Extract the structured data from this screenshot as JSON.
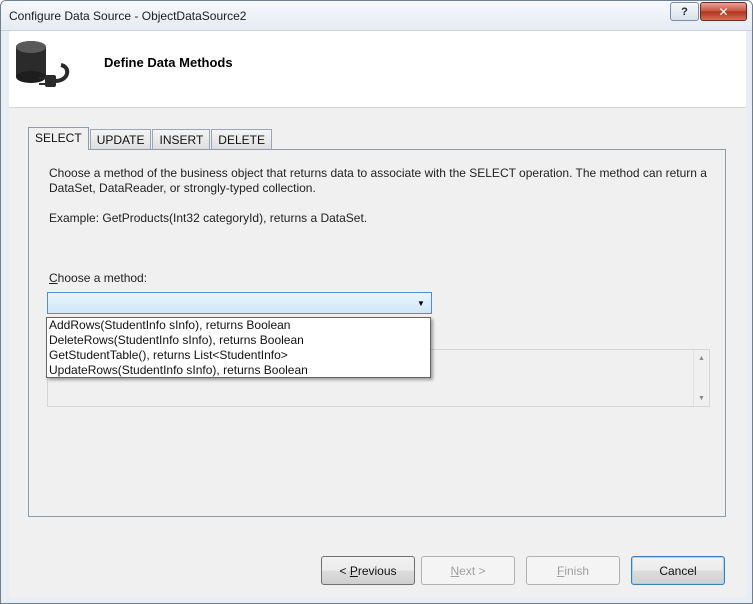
{
  "window": {
    "title": "Configure Data Source - ObjectDataSource2",
    "help_label": "?",
    "close_label": "✕"
  },
  "banner": {
    "icon": "database-plug-icon",
    "title": "Define Data Methods"
  },
  "tabs": [
    {
      "label": "SELECT",
      "active": true
    },
    {
      "label": "UPDATE",
      "active": false
    },
    {
      "label": "INSERT",
      "active": false
    },
    {
      "label": "DELETE",
      "active": false
    }
  ],
  "panel": {
    "description": "Choose a method of the business object that returns data to associate with the SELECT operation. The method can return a DataSet, DataReader, or strongly-typed collection.",
    "example": "Example: GetProducts(Int32 categoryId), returns a DataSet.",
    "choose_label_mnemonic": "C",
    "choose_label_rest": "hoose a method:",
    "method_selected_value": "",
    "method_options": [
      "AddRows(StudentInfo sInfo), returns Boolean",
      "DeleteRows(StudentInfo sInfo), returns Boolean",
      "GetStudentTable(), returns List<StudentInfo>",
      "UpdateRows(StudentInfo sInfo), returns Boolean"
    ],
    "signature_text": ""
  },
  "buttons": {
    "previous_mnemonic": "P",
    "previous_prefix": "< ",
    "previous_rest": "revious",
    "next_mnemonic": "N",
    "next_rest": "ext >",
    "finish_mnemonic": "F",
    "finish_rest": "inish",
    "cancel": "Cancel"
  }
}
